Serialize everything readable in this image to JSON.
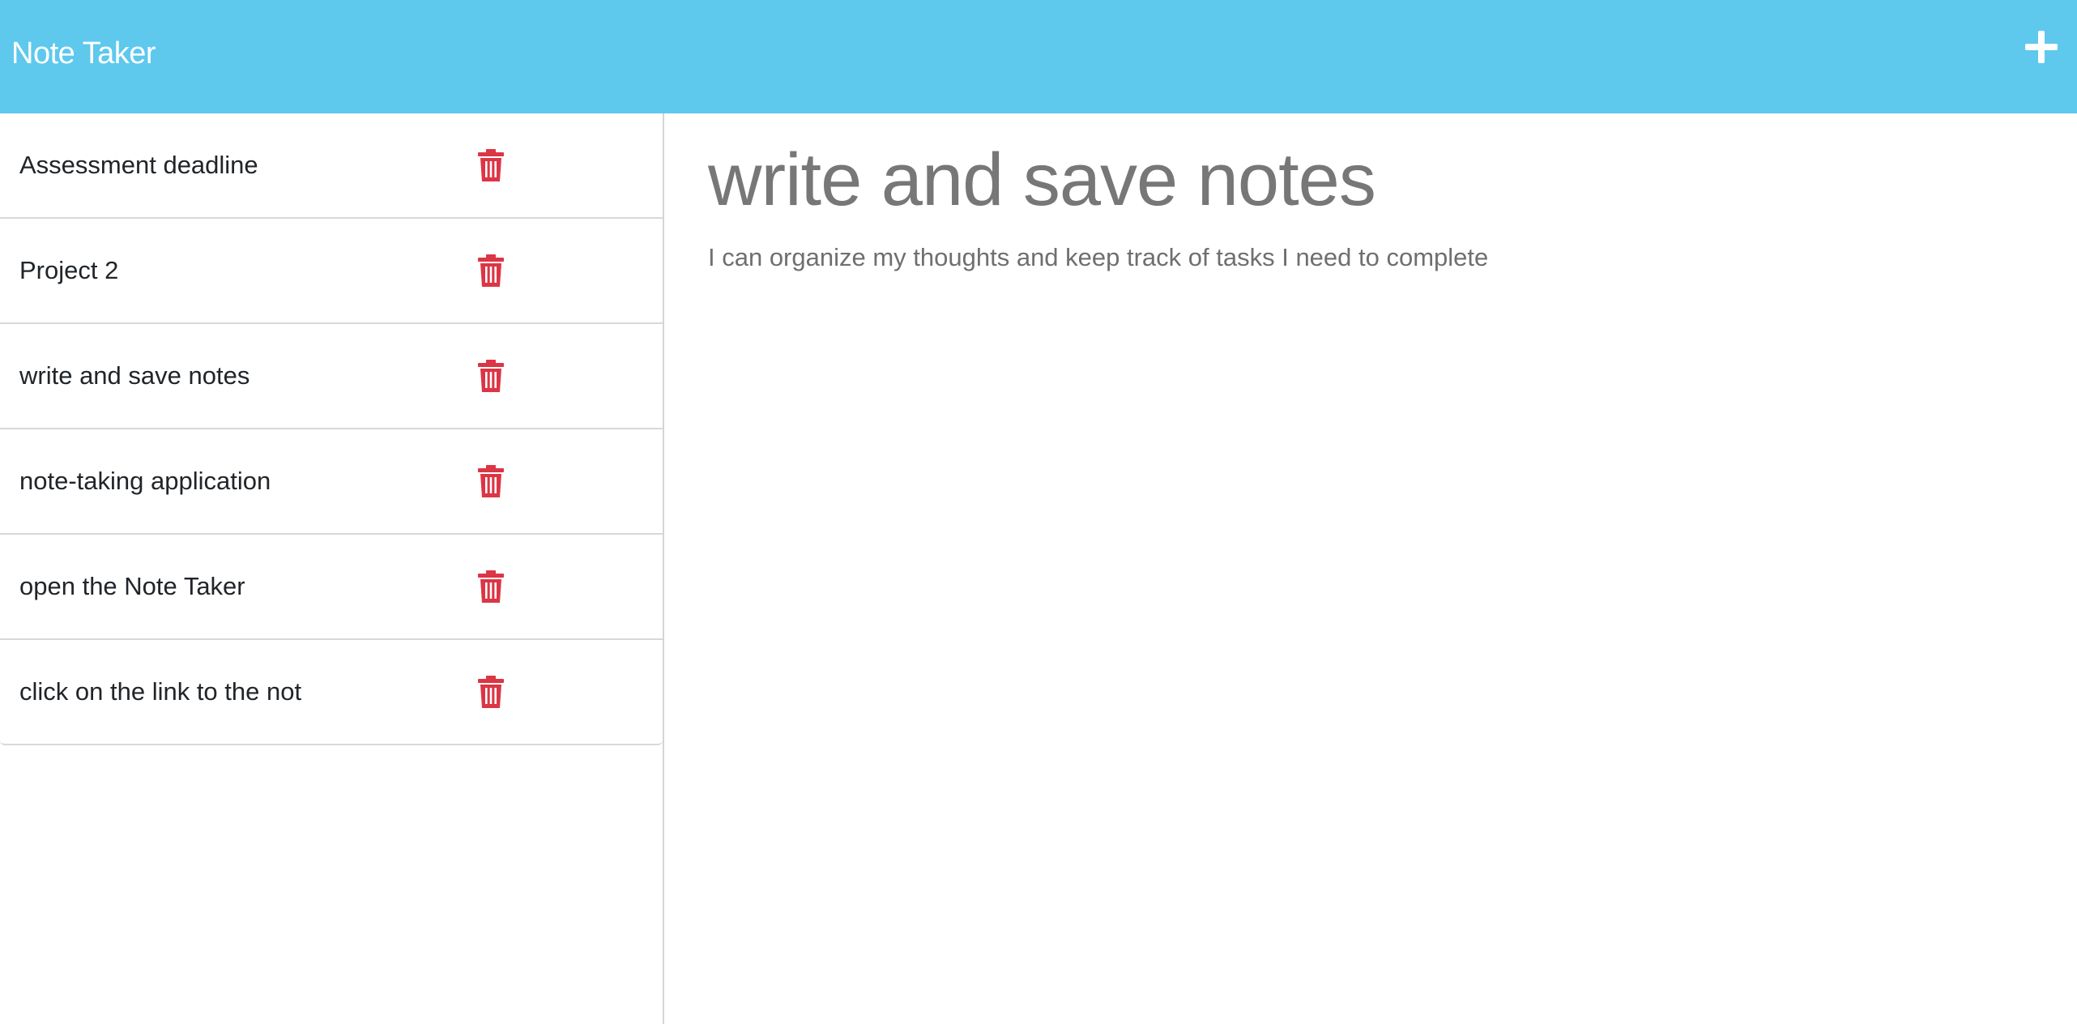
{
  "header": {
    "brand": "Note Taker",
    "new_note_icon": "plus-icon"
  },
  "sidebar": {
    "notes": [
      {
        "title": "Assessment deadline",
        "icon": "trash-icon"
      },
      {
        "title": "Project 2",
        "icon": "trash-icon"
      },
      {
        "title": "write and save notes",
        "icon": "trash-icon"
      },
      {
        "title": "note-taking application",
        "icon": "trash-icon"
      },
      {
        "title": "open the Note Taker",
        "icon": "trash-icon"
      },
      {
        "title": "click on the link to the not",
        "icon": "trash-icon"
      }
    ]
  },
  "main": {
    "note_title": "write and save notes",
    "note_text": "I can organize my thoughts and keep track of tasks I need to complete"
  },
  "colors": {
    "navbar": "#5ec8ed",
    "delete": "#dc3545",
    "title_text": "#777777"
  }
}
